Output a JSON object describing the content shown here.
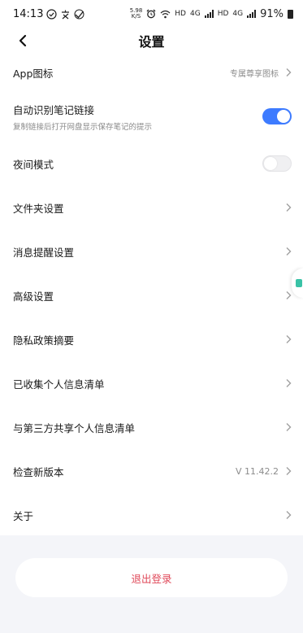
{
  "status_bar": {
    "time": "14:13",
    "left_icons": [
      "check-circle-icon",
      "app-icon",
      "check-icon"
    ],
    "net_speed_top": "5.98",
    "net_speed_bottom": "K/S",
    "hd1": "HD",
    "hd2": "HD",
    "lte1": "4G",
    "lte2": "4G",
    "battery": "91%"
  },
  "header": {
    "title": "设置"
  },
  "settings": {
    "app_icon": {
      "label": "App图标",
      "value": "专属尊享图标"
    },
    "auto_link": {
      "label": "自动识别笔记链接",
      "sub": "复制链接后打开网盘显示保存笔记的提示",
      "enabled": true
    },
    "night_mode": {
      "label": "夜间模式",
      "enabled": false
    },
    "folder": {
      "label": "文件夹设置"
    },
    "notify": {
      "label": "消息提醒设置"
    },
    "advanced": {
      "label": "高级设置"
    },
    "privacy": {
      "label": "隐私政策摘要"
    },
    "collected": {
      "label": "已收集个人信息清单"
    },
    "shared": {
      "label": "与第三方共享个人信息清单"
    },
    "update": {
      "label": "检查新版本",
      "value": "V 11.42.2"
    },
    "about": {
      "label": "关于"
    }
  },
  "footer": {
    "logout_label": "退出登录"
  },
  "colors": {
    "accent": "#3d7bff",
    "logout": "#e04a5a",
    "footer_bg": "#f4f5f9"
  }
}
